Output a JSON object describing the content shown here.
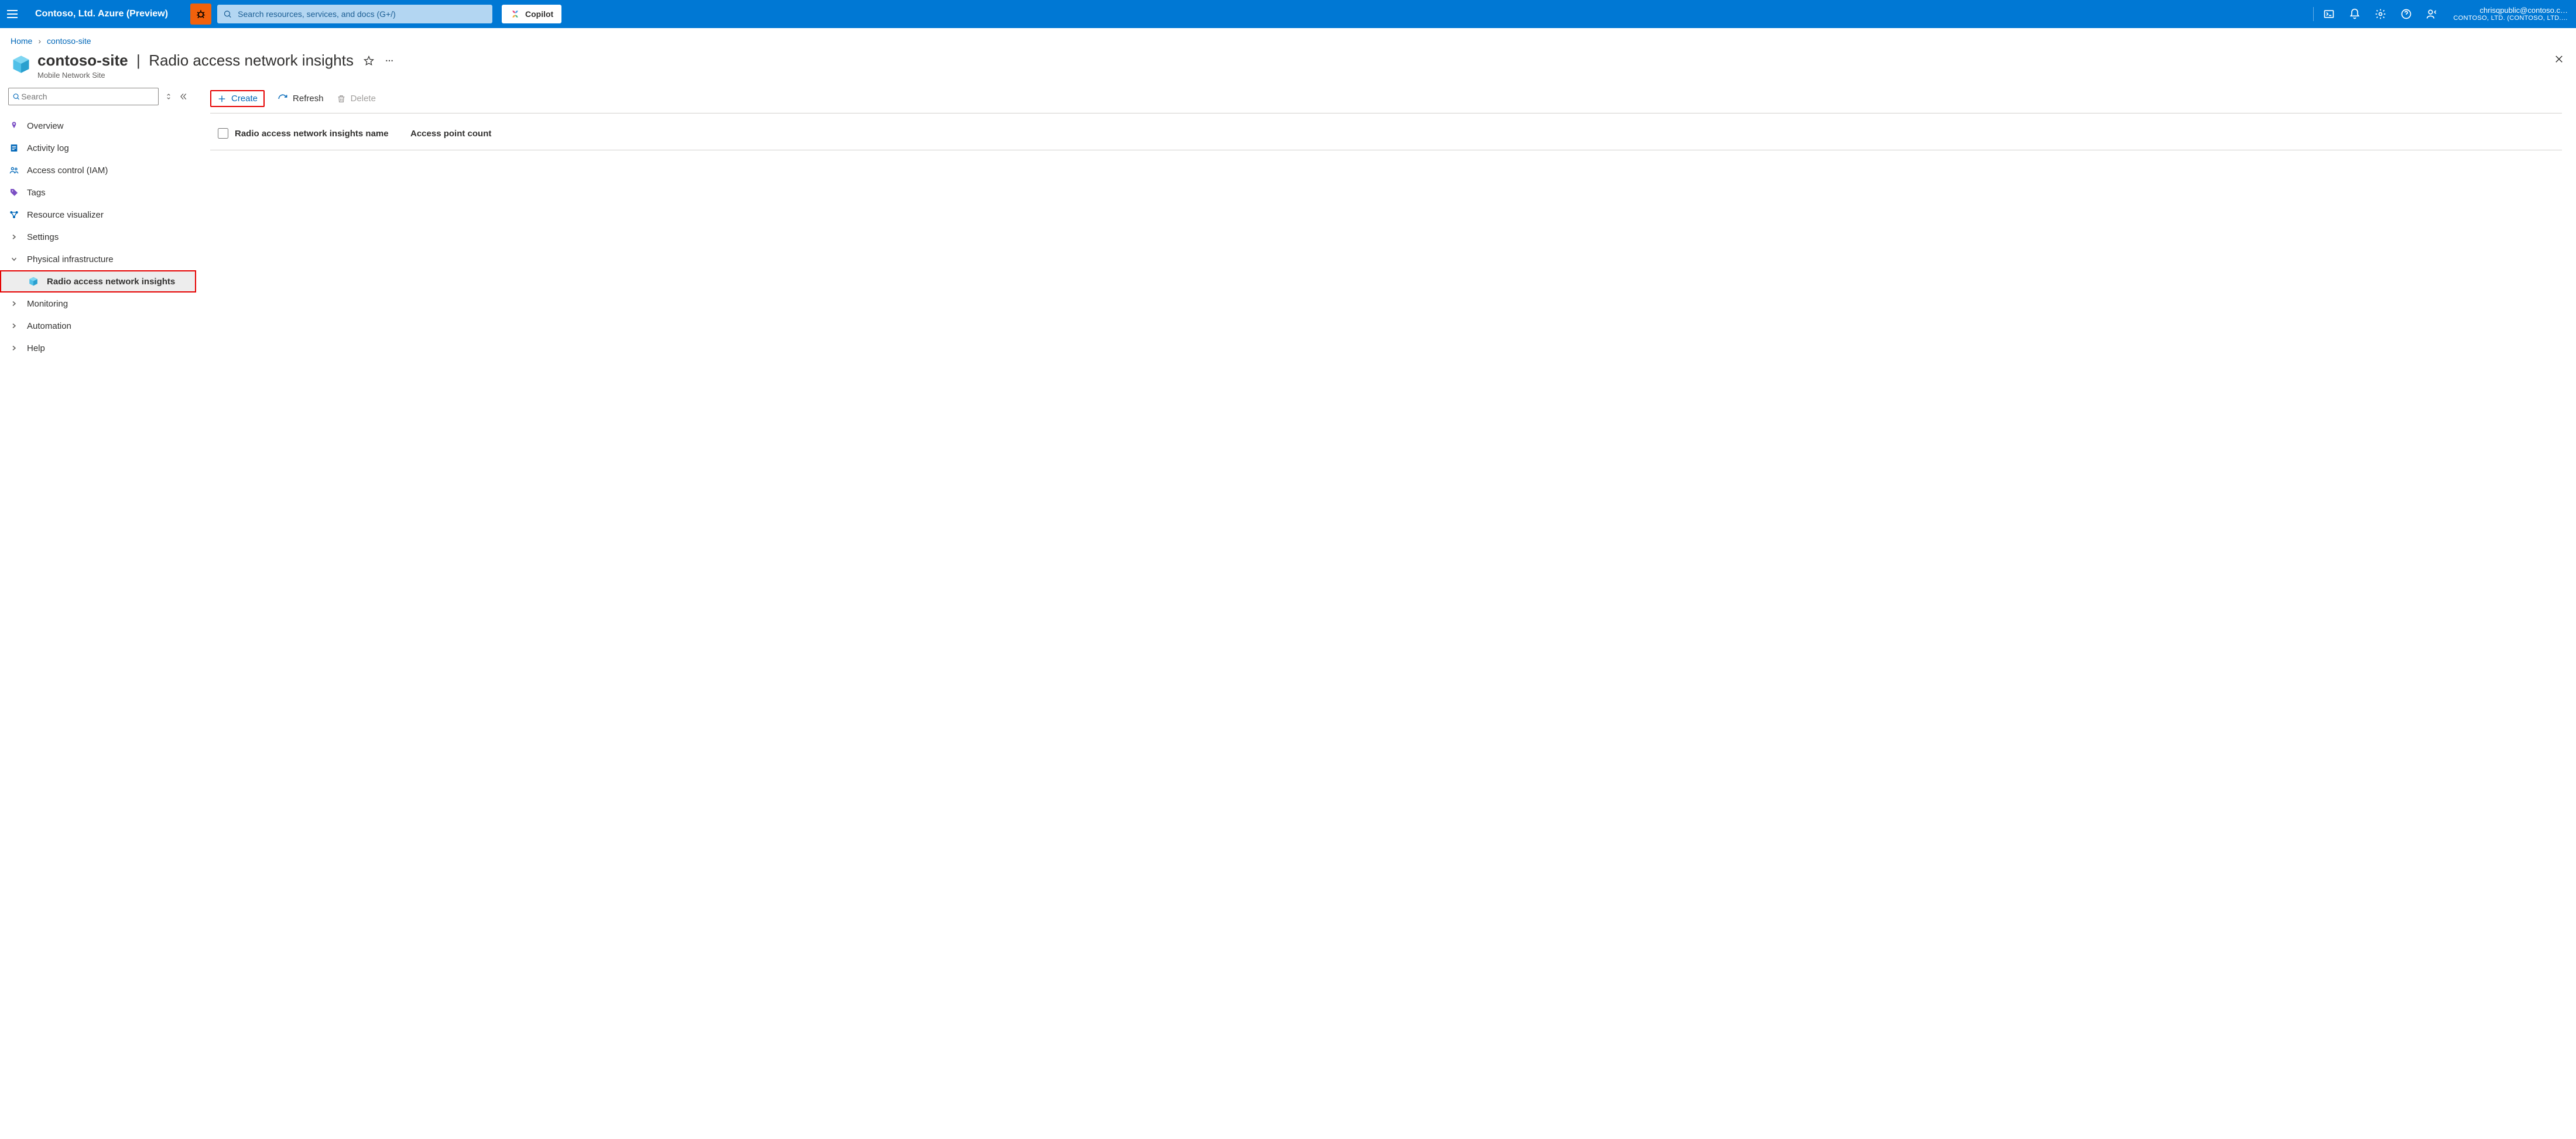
{
  "topbar": {
    "tenant": "Contoso, Ltd. Azure (Preview)",
    "search_placeholder": "Search resources, services, and docs (G+/)",
    "copilot": "Copilot",
    "account_email": "chrisqpublic@contoso.c…",
    "account_org": "CONTOSO, LTD. (CONTOSO, LTD.…"
  },
  "breadcrumbs": {
    "home": "Home",
    "site": "contoso-site"
  },
  "header": {
    "resource": "contoso-site",
    "page": "Radio access network insights",
    "subtitle": "Mobile Network Site"
  },
  "sidebar": {
    "search_placeholder": "Search",
    "items": [
      {
        "label": "Overview",
        "icon": "pin"
      },
      {
        "label": "Activity log",
        "icon": "log"
      },
      {
        "label": "Access control (IAM)",
        "icon": "people"
      },
      {
        "label": "Tags",
        "icon": "tag"
      },
      {
        "label": "Resource visualizer",
        "icon": "graph"
      },
      {
        "label": "Settings",
        "icon": "chevron"
      },
      {
        "label": "Physical infrastructure",
        "icon": "chevron-down"
      },
      {
        "label": "Radio access network insights",
        "icon": "cube",
        "sub": true,
        "selected": true,
        "highlight": true
      },
      {
        "label": "Monitoring",
        "icon": "chevron"
      },
      {
        "label": "Automation",
        "icon": "chevron"
      },
      {
        "label": "Help",
        "icon": "chevron"
      }
    ]
  },
  "commands": {
    "create": "Create",
    "refresh": "Refresh",
    "delete": "Delete"
  },
  "table": {
    "col1": "Radio access network insights name",
    "col2": "Access point count"
  }
}
